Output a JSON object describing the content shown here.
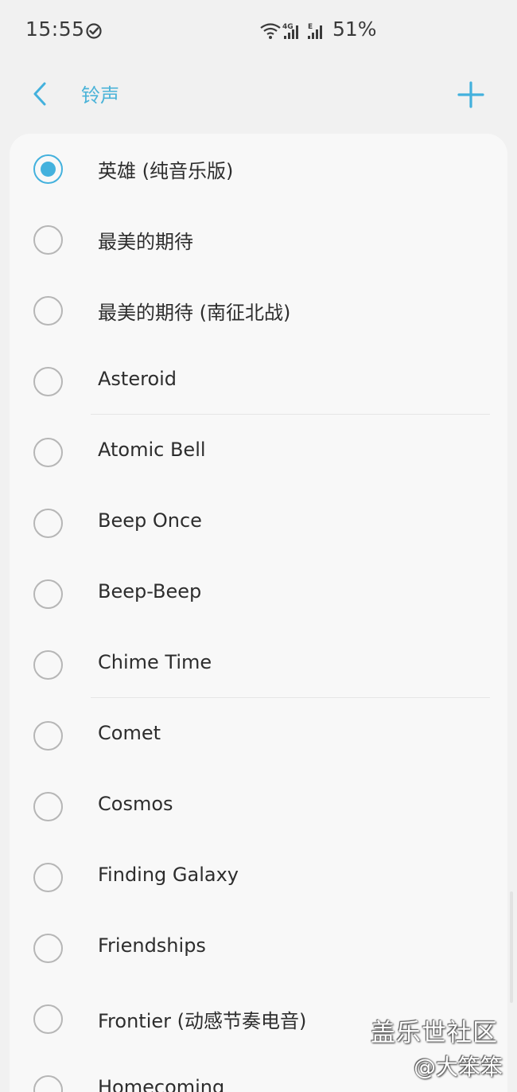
{
  "status_bar": {
    "time": "15:55",
    "battery": "51%",
    "network_label": "4G",
    "edge_label": "E",
    "sync_icon": "check-circle-icon",
    "wifi_icon": "wifi-icon"
  },
  "header": {
    "title": "铃声",
    "back_icon": "chevron-left-icon",
    "add_icon": "plus-icon"
  },
  "ringtones": [
    {
      "label": "英雄 (纯音乐版)",
      "selected": true
    },
    {
      "label": "最美的期待",
      "selected": false
    },
    {
      "label": "最美的期待 (南征北战)",
      "selected": false
    },
    {
      "label": "Asteroid",
      "selected": false
    },
    {
      "label": "Atomic Bell",
      "selected": false
    },
    {
      "label": "Beep Once",
      "selected": false
    },
    {
      "label": "Beep-Beep",
      "selected": false
    },
    {
      "label": "Chime Time",
      "selected": false
    },
    {
      "label": "Comet",
      "selected": false
    },
    {
      "label": "Cosmos",
      "selected": false
    },
    {
      "label": "Finding Galaxy",
      "selected": false
    },
    {
      "label": "Friendships",
      "selected": false
    },
    {
      "label": "Frontier (动感节奏电音)",
      "selected": false
    },
    {
      "label": "Homecoming",
      "selected": false
    }
  ],
  "watermark": {
    "line1": "盖乐世社区",
    "line2": "@大笨笨"
  },
  "colors": {
    "accent": "#43b1dd",
    "title": "#4ab3d8",
    "background": "#f1f1f1",
    "card": "#f8f8f8"
  }
}
